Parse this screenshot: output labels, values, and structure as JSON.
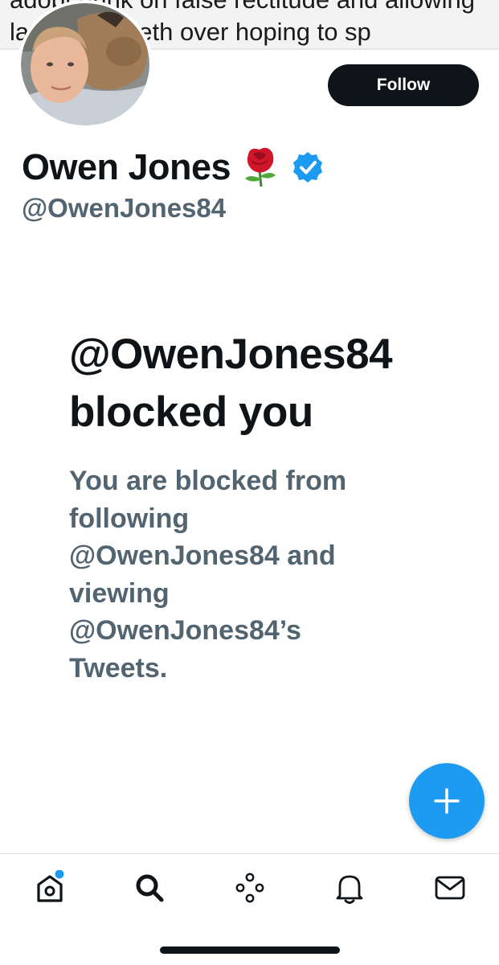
{
  "banner": {
    "line1": "adopt drink on false rectitude and allowing",
    "line2": "lazy to runneth over hoping to sp"
  },
  "profile": {
    "display_name": "Owen Jones",
    "handle": "@OwenJones84",
    "follow_label": "Follow",
    "name_emoji_icon": "rose-icon",
    "verified_icon": "verified-badge-icon"
  },
  "blocked": {
    "title": "@OwenJones84 blocked you",
    "description": "You are blocked from following @OwenJones84 and viewing @OwenJones84’s Tweets."
  },
  "fab": {
    "icon": "plus-icon",
    "color": "#1d9bf0"
  },
  "nav": {
    "items": [
      {
        "name": "home",
        "icon": "home-icon",
        "has_notification_dot": true
      },
      {
        "name": "search",
        "icon": "search-icon"
      },
      {
        "name": "spaces",
        "icon": "spaces-icon"
      },
      {
        "name": "notifications",
        "icon": "bell-icon"
      },
      {
        "name": "messages",
        "icon": "mail-icon"
      }
    ]
  },
  "colors": {
    "accent": "#1d9bf0",
    "text_primary": "#0f1419",
    "text_secondary": "#536471"
  }
}
